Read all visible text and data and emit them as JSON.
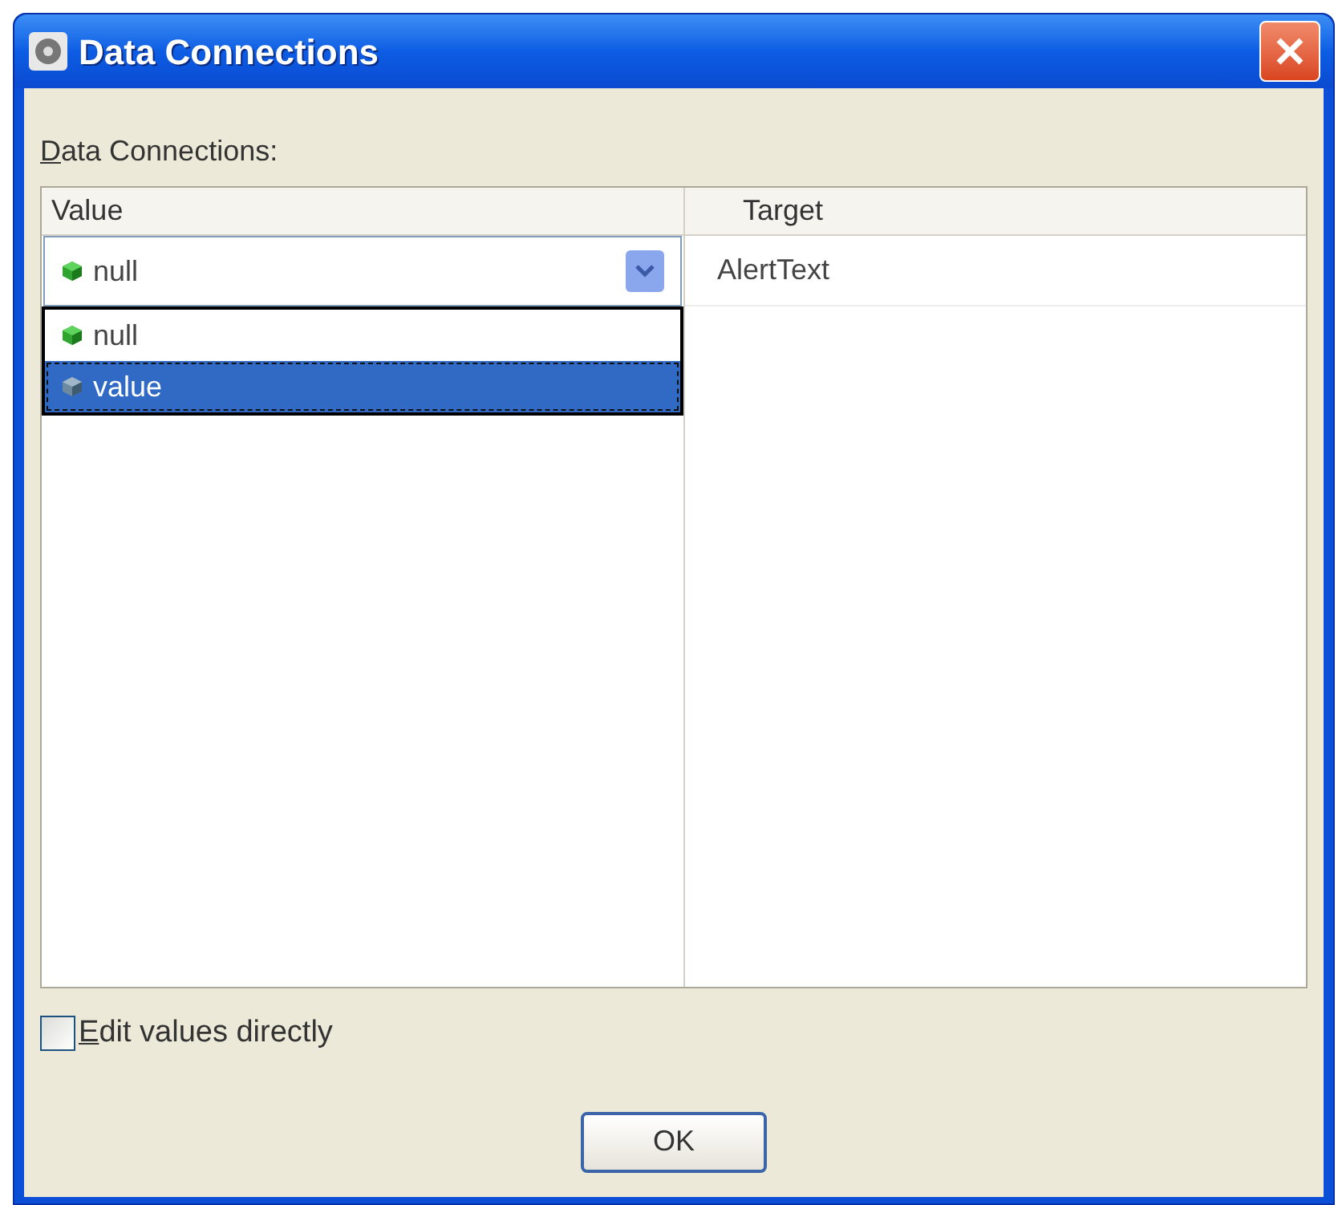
{
  "window": {
    "title": "Data Connections"
  },
  "label": "Data Connections:",
  "table": {
    "columns": [
      "Value",
      "Target"
    ],
    "rows": [
      {
        "value": "null",
        "target": "AlertText",
        "expanded": true
      }
    ]
  },
  "dropdown": [
    {
      "label": "null",
      "selected": false,
      "kind": "green"
    },
    {
      "label": "value",
      "selected": true,
      "kind": "grey"
    }
  ],
  "checkbox": {
    "label": "Edit values directly",
    "checked": false
  },
  "buttons": [
    "OK"
  ]
}
